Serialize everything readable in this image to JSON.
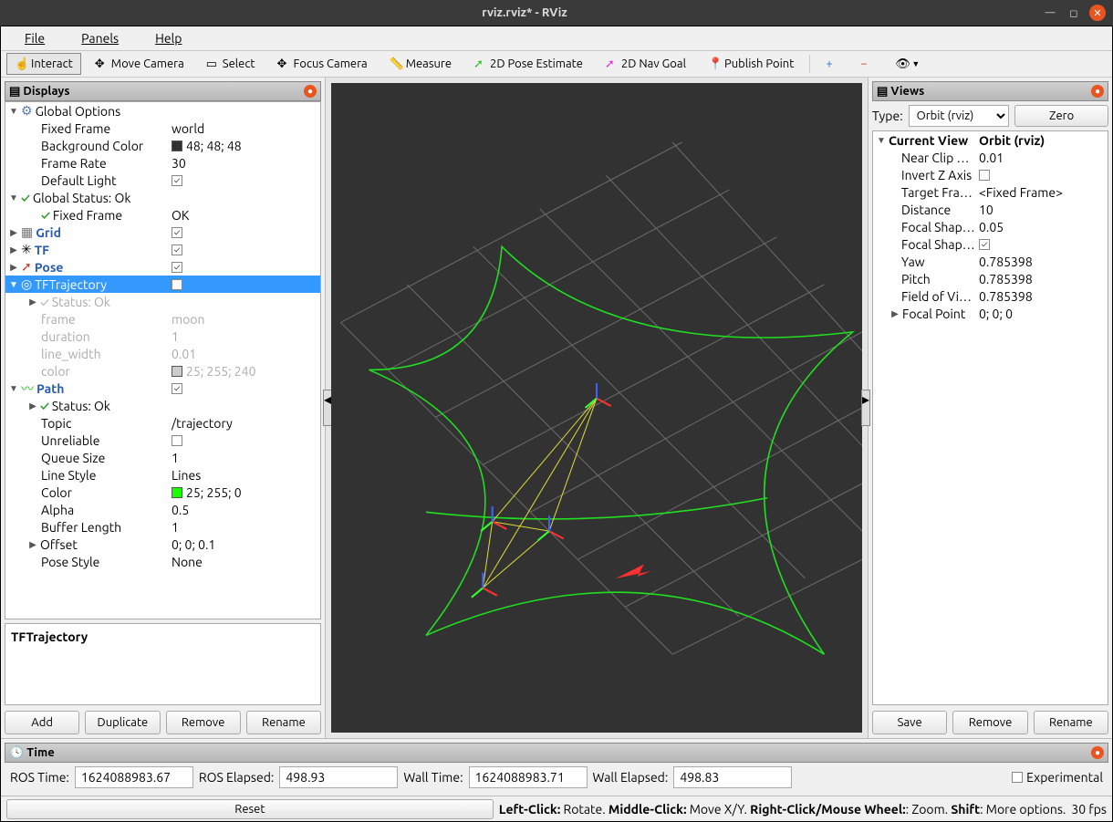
{
  "titlebar": {
    "title": "rviz.rviz* - RViz"
  },
  "menubar": {
    "file": "File",
    "panels": "Panels",
    "help": "Help"
  },
  "toolbar": {
    "interact": "Interact",
    "move_camera": "Move Camera",
    "select": "Select",
    "focus_camera": "Focus Camera",
    "measure": "Measure",
    "pose_estimate": "2D Pose Estimate",
    "nav_goal": "2D Nav Goal",
    "publish_point": "Publish Point"
  },
  "displays": {
    "title": "Displays",
    "global_options": {
      "label": "Global Options",
      "fixed_frame": {
        "label": "Fixed Frame",
        "value": "world"
      },
      "bg_color": {
        "label": "Background Color",
        "value": "48; 48; 48",
        "hex": "#303030"
      },
      "frame_rate": {
        "label": "Frame Rate",
        "value": "30"
      },
      "default_light": {
        "label": "Default Light",
        "checked": true
      }
    },
    "global_status": {
      "label": "Global Status: Ok",
      "fixed_frame": {
        "label": "Fixed Frame",
        "value": "OK"
      }
    },
    "grid": {
      "label": "Grid",
      "checked": true
    },
    "tf": {
      "label": "TF",
      "checked": true
    },
    "pose": {
      "label": "Pose",
      "checked": true
    },
    "tftraj": {
      "label": "TFTrajectory",
      "checked": false,
      "status": {
        "label": "Status: Ok"
      },
      "frame": {
        "label": "frame",
        "value": "moon"
      },
      "duration": {
        "label": "duration",
        "value": "1"
      },
      "line_width": {
        "label": "line_width",
        "value": "0.01"
      },
      "color": {
        "label": "color",
        "value": "25; 255; 240",
        "hex": "#ccc"
      }
    },
    "path": {
      "label": "Path",
      "checked": true,
      "status": {
        "label": "Status: Ok"
      },
      "topic": {
        "label": "Topic",
        "value": "/trajectory"
      },
      "unreliable": {
        "label": "Unreliable",
        "checked": false
      },
      "queue_size": {
        "label": "Queue Size",
        "value": "1"
      },
      "line_style": {
        "label": "Line Style",
        "value": "Lines"
      },
      "color": {
        "label": "Color",
        "value": "25; 255; 0",
        "hex": "#19ff00"
      },
      "alpha": {
        "label": "Alpha",
        "value": "0.5"
      },
      "buffer_length": {
        "label": "Buffer Length",
        "value": "1"
      },
      "offset": {
        "label": "Offset",
        "value": "0; 0; 0.1"
      },
      "pose_style": {
        "label": "Pose Style",
        "value": "None"
      }
    },
    "description": "TFTrajectory",
    "buttons": {
      "add": "Add",
      "duplicate": "Duplicate",
      "remove": "Remove",
      "rename": "Rename"
    }
  },
  "views": {
    "title": "Views",
    "type_label": "Type:",
    "type_value": "Orbit (rviz)",
    "zero": "Zero",
    "current_view": {
      "label": "Current View",
      "value": "Orbit (rviz)"
    },
    "near_clip": {
      "label": "Near Clip …",
      "value": "0.01"
    },
    "invert_z": {
      "label": "Invert Z Axis",
      "checked": false
    },
    "target_frame": {
      "label": "Target Fra…",
      "value": "<Fixed Frame>"
    },
    "distance": {
      "label": "Distance",
      "value": "10"
    },
    "focal_shape_size": {
      "label": "Focal Shap…",
      "value": "0.05"
    },
    "focal_shape_fixed": {
      "label": "Focal Shap…",
      "checked": true
    },
    "yaw": {
      "label": "Yaw",
      "value": "0.785398"
    },
    "pitch": {
      "label": "Pitch",
      "value": "0.785398"
    },
    "fov": {
      "label": "Field of Vi…",
      "value": "0.785398"
    },
    "focal_point": {
      "label": "Focal Point",
      "value": "0; 0; 0"
    },
    "buttons": {
      "save": "Save",
      "remove": "Remove",
      "rename": "Rename"
    }
  },
  "time": {
    "title": "Time",
    "ros_time_label": "ROS Time:",
    "ros_time": "1624088983.67",
    "ros_elapsed_label": "ROS Elapsed:",
    "ros_elapsed": "498.93",
    "wall_time_label": "Wall Time:",
    "wall_time": "1624088983.71",
    "wall_elapsed_label": "Wall Elapsed:",
    "wall_elapsed": "498.83",
    "experimental": "Experimental"
  },
  "status": {
    "reset": "Reset",
    "hint_left": "Left-Click:",
    "hint_left_v": " Rotate. ",
    "hint_mid": "Middle-Click:",
    "hint_mid_v": " Move X/Y. ",
    "hint_right": "Right-Click/Mouse Wheel:",
    "hint_right_v": ": Zoom. ",
    "hint_shift": "Shift",
    "hint_shift_v": ": More options.",
    "fps": "30 fps"
  }
}
